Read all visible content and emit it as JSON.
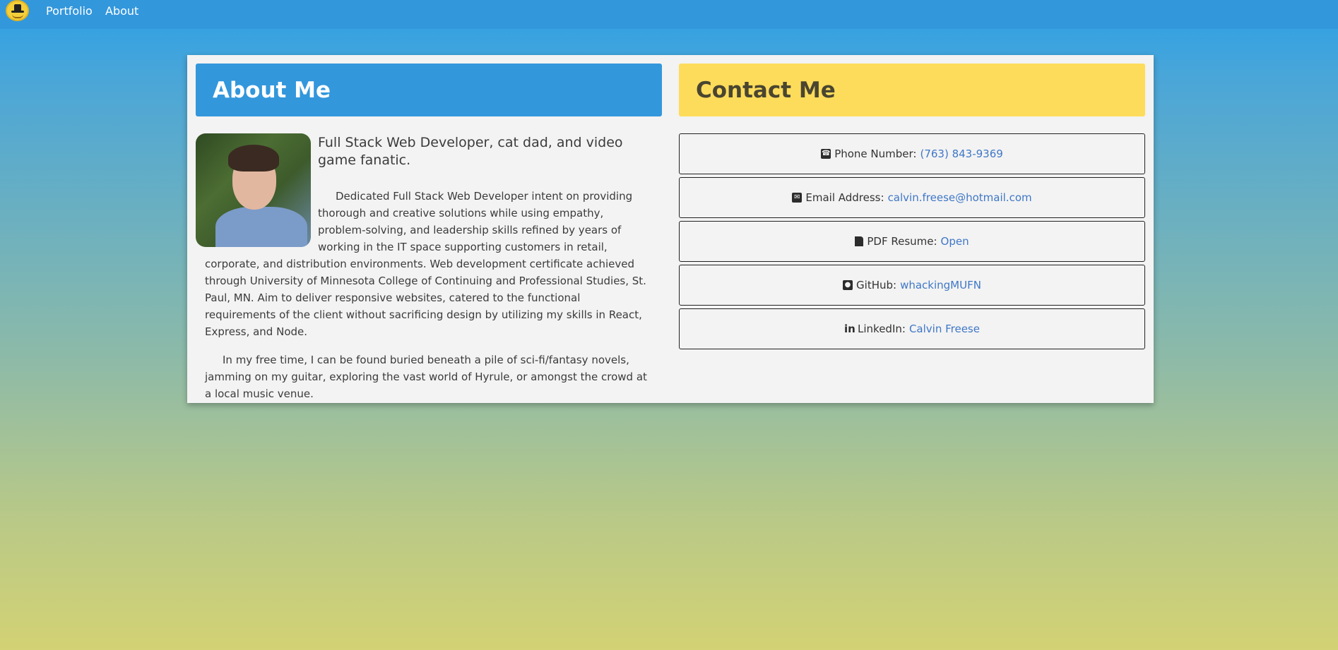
{
  "nav": {
    "logo": "hat-smiley-logo",
    "links": [
      "Portfolio",
      "About"
    ]
  },
  "about": {
    "title": "About Me",
    "tagline": "Full Stack Web Developer, cat dad, and video game fanatic.",
    "bio1": "Dedicated Full Stack Web Developer intent on providing thorough and creative solutions while using empathy, problem-solving, and leadership skills refined by years of working in the IT space supporting customers in retail, corporate, and distribution environments. Web development certificate achieved through University of Minnesota College of Continuing and Professional Studies, St. Paul, MN. Aim to deliver responsive websites, catered to the functional requirements of the client without sacrificing design by utilizing my skills in React, Express, and Node.",
    "bio2": "In my free time, I can be found buried beneath a pile of sci-fi/fantasy novels, jamming on my guitar, exploring the vast world of Hyrule, or amongst the crowd at a local music venue."
  },
  "contact": {
    "title": "Contact Me",
    "items": [
      {
        "icon": "phone-icon",
        "label": "Phone Number:",
        "value": "(763) 843-9369"
      },
      {
        "icon": "envelope-icon",
        "label": "Email Address:",
        "value": "calvin.freese@hotmail.com"
      },
      {
        "icon": "file-icon",
        "label": "PDF Resume:",
        "value": "Open"
      },
      {
        "icon": "github-icon",
        "label": "GitHub:",
        "value": "whackingMUFN"
      },
      {
        "icon": "linkedin-icon",
        "label": "LinkedIn:",
        "value": "Calvin Freese"
      }
    ]
  },
  "colors": {
    "nav": "#3397dc",
    "about_header": "#3397dc",
    "contact_header": "#fedc5b",
    "link": "#3f77c7"
  }
}
